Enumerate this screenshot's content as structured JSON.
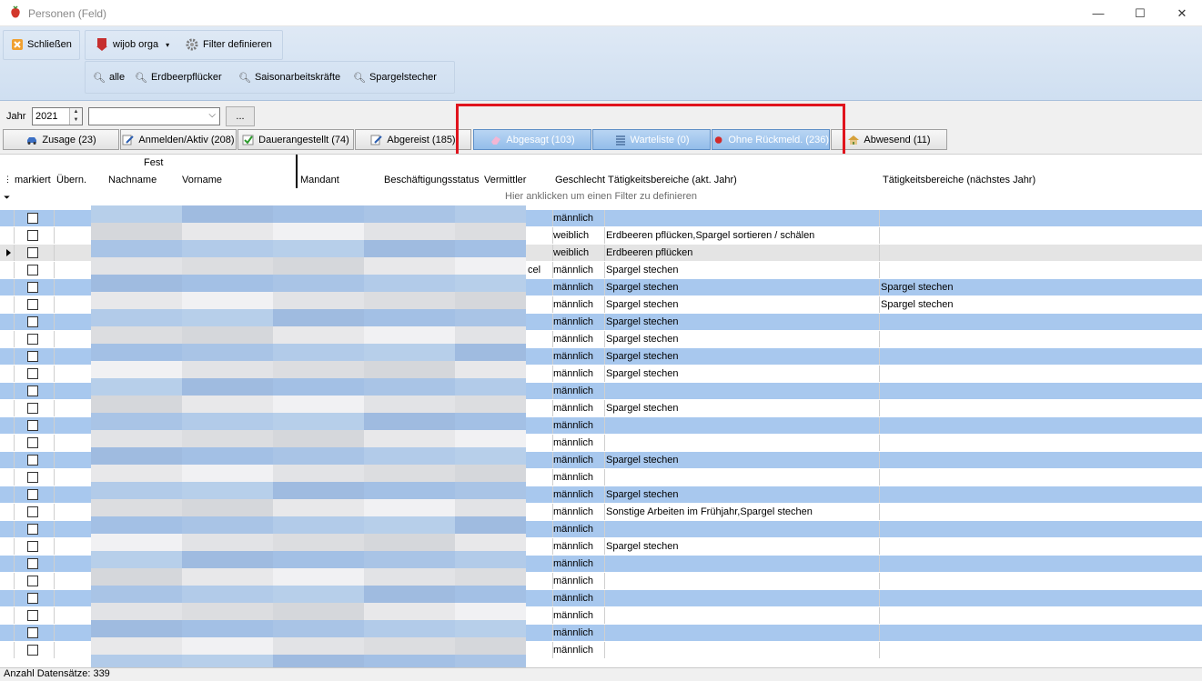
{
  "window": {
    "title": "Personen (Feld)",
    "minimize": "—",
    "maximize": "☐",
    "close": "✕"
  },
  "toolbar": {
    "close_label": "Schließen",
    "wijob_label": "wijob orga",
    "filter_define_label": "Filter definieren",
    "quick_filters": [
      "alle",
      "Erdbeerpflücker",
      "Saisonarbeitskräfte",
      "Spargelstecher"
    ]
  },
  "filters": {
    "year_label": "Jahr",
    "year_value": "2021",
    "combo_value": "",
    "dots_label": "..."
  },
  "tabs": [
    {
      "label": "Zusage (23)",
      "icon": "car-icon",
      "active": false
    },
    {
      "label": "Anmelden/Aktiv (208)",
      "icon": "pencil-icon",
      "active": false
    },
    {
      "label": "Dauerangestellt (74)",
      "icon": "check-icon",
      "active": false
    },
    {
      "label": "Abgereist (185)",
      "icon": "pencil-icon",
      "active": false
    },
    {
      "label": "Abgesagt (103)",
      "icon": "eraser-icon",
      "active": true
    },
    {
      "label": "Warteliste (0)",
      "icon": "list-icon",
      "active": true
    },
    {
      "label": "Ohne Rückmeld. (236)",
      "icon": "red-dot-icon",
      "active": true
    },
    {
      "label": "Abwesend (11)",
      "icon": "house-icon",
      "active": false
    }
  ],
  "grid": {
    "group_header": "Fest",
    "columns": [
      "markiert",
      "Übern.",
      "Nachname",
      "Vorname",
      "Mandant",
      "Beschäftigungsstatus",
      "Vermittler",
      "Geschlecht",
      "Tätigkeitsbereiche (akt. Jahr)",
      "Tätigkeitsbereiche (nächstes Jahr)"
    ],
    "filter_hint": "Hier anklicken um einen Filter zu definieren",
    "rows": [
      {
        "style": "blue",
        "vermittler": "",
        "gender": "männlich",
        "taet": "",
        "next": ""
      },
      {
        "style": "white",
        "vermittler": "",
        "gender": "weiblich",
        "taet": "Erdbeeren pflücken,Spargel sortieren / schälen",
        "next": ""
      },
      {
        "style": "sel",
        "vermittler": "",
        "gender": "weiblich",
        "taet": "Erdbeeren pflücken",
        "next": "",
        "current": true
      },
      {
        "style": "white",
        "vermittler": "cel",
        "gender": "männlich",
        "taet": "Spargel stechen",
        "next": ""
      },
      {
        "style": "blue",
        "vermittler": "",
        "gender": "männlich",
        "taet": "Spargel stechen",
        "next": "Spargel stechen"
      },
      {
        "style": "white",
        "vermittler": "",
        "gender": "männlich",
        "taet": "Spargel stechen",
        "next": "Spargel stechen"
      },
      {
        "style": "blue",
        "vermittler": "",
        "gender": "männlich",
        "taet": "Spargel stechen",
        "next": ""
      },
      {
        "style": "white",
        "vermittler": "",
        "gender": "männlich",
        "taet": "Spargel stechen",
        "next": ""
      },
      {
        "style": "blue",
        "vermittler": "",
        "gender": "männlich",
        "taet": "Spargel stechen",
        "next": ""
      },
      {
        "style": "white",
        "vermittler": "",
        "gender": "männlich",
        "taet": "Spargel stechen",
        "next": ""
      },
      {
        "style": "blue",
        "vermittler": "",
        "gender": "männlich",
        "taet": "",
        "next": ""
      },
      {
        "style": "white",
        "vermittler": "",
        "gender": "männlich",
        "taet": "Spargel stechen",
        "next": ""
      },
      {
        "style": "blue",
        "vermittler": "",
        "gender": "männlich",
        "taet": "",
        "next": ""
      },
      {
        "style": "white",
        "vermittler": "",
        "gender": "männlich",
        "taet": "",
        "next": ""
      },
      {
        "style": "blue",
        "vermittler": "",
        "gender": "männlich",
        "taet": "Spargel stechen",
        "next": ""
      },
      {
        "style": "white",
        "vermittler": "",
        "gender": "männlich",
        "taet": "",
        "next": ""
      },
      {
        "style": "blue",
        "vermittler": "",
        "gender": "männlich",
        "taet": "Spargel stechen",
        "next": ""
      },
      {
        "style": "white",
        "vermittler": "",
        "gender": "männlich",
        "taet": "Sonstige Arbeiten im Frühjahr,Spargel stechen",
        "next": ""
      },
      {
        "style": "blue",
        "vermittler": "",
        "gender": "männlich",
        "taet": "",
        "next": ""
      },
      {
        "style": "white",
        "vermittler": "",
        "gender": "männlich",
        "taet": "Spargel stechen",
        "next": ""
      },
      {
        "style": "blue",
        "vermittler": "",
        "gender": "männlich",
        "taet": "",
        "next": ""
      },
      {
        "style": "white",
        "vermittler": "",
        "gender": "männlich",
        "taet": "",
        "next": ""
      },
      {
        "style": "blue",
        "vermittler": "",
        "gender": "männlich",
        "taet": "",
        "next": ""
      },
      {
        "style": "white",
        "vermittler": "",
        "gender": "männlich",
        "taet": "",
        "next": ""
      },
      {
        "style": "blue",
        "vermittler": "",
        "gender": "männlich",
        "taet": "",
        "next": ""
      },
      {
        "style": "white",
        "vermittler": "",
        "gender": "männlich",
        "taet": "",
        "next": ""
      }
    ]
  },
  "status": {
    "record_count": "Anzahl Datensätze: 339"
  },
  "colors": {
    "row_blue": "#a8c8ee",
    "active_tab": "#93bdea",
    "highlight_box": "#e0141d"
  }
}
